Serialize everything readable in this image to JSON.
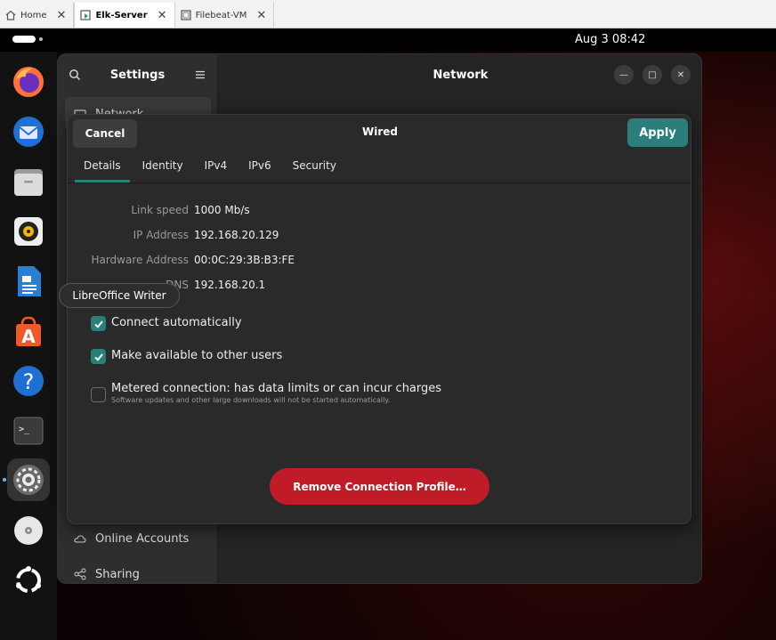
{
  "vm_tabs": [
    {
      "label": "Home",
      "icon": "home-icon"
    },
    {
      "label": "Elk-Server",
      "icon": "vm-running-icon"
    },
    {
      "label": "Filebeat-VM",
      "icon": "vm-icon"
    }
  ],
  "topbar": {
    "clock": "Aug 3  08:42"
  },
  "dock": {
    "items": [
      "firefox",
      "thunderbird",
      "files",
      "rhythmbox",
      "libreoffice-writer",
      "app-center",
      "help",
      "terminal",
      "settings",
      "dvd",
      "show-apps"
    ],
    "tooltip": "LibreOffice Writer"
  },
  "settings": {
    "title": "Settings",
    "main_title": "Network",
    "sidebar": {
      "items": [
        {
          "label": "Network",
          "icon": "network-icon"
        },
        {
          "label": "Online Accounts",
          "icon": "cloud-icon"
        },
        {
          "label": "Sharing",
          "icon": "share-icon"
        }
      ]
    }
  },
  "dialog": {
    "title": "Wired",
    "cancel_label": "Cancel",
    "apply_label": "Apply",
    "tabs": [
      "Details",
      "Identity",
      "IPv4",
      "IPv6",
      "Security"
    ],
    "active_tab": "Details",
    "details": [
      {
        "label": "Link speed",
        "value": "1000 Mb/s"
      },
      {
        "label": "IP Address",
        "value": "192.168.20.129"
      },
      {
        "label": "Hardware Address",
        "value": "00:0C:29:3B:B3:FE"
      },
      {
        "label": "DNS",
        "value": "192.168.20.1"
      }
    ],
    "options": [
      {
        "label": "Connect automatically",
        "checked": true
      },
      {
        "label": "Make available to other users",
        "checked": true
      },
      {
        "label": "Metered connection: has data limits or can incur charges",
        "sublabel": "Software updates and other large downloads will not be started automatically.",
        "checked": false
      }
    ],
    "remove_label": "Remove Connection Profile…"
  },
  "colors": {
    "accent": "#2b7f7a",
    "destructive": "#c01c28"
  }
}
